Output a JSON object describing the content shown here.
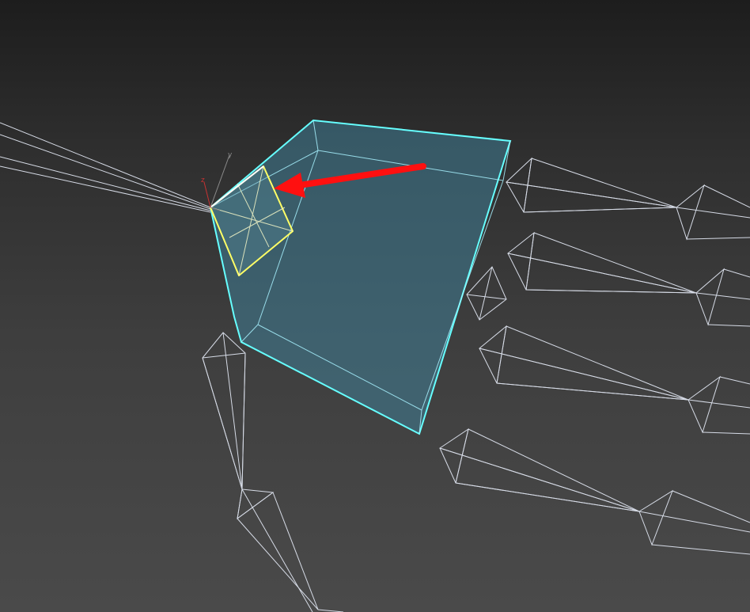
{
  "viewport": {
    "label": "",
    "background": "#3a3a3a"
  },
  "gizmo": {
    "x_label": "",
    "y_label": "y",
    "z_label": "z",
    "y_color": "#8a8a8a",
    "z_color": "#c83232"
  },
  "colors": {
    "bone_wire": "#d6dbe6",
    "selection_wire": "#66ffff",
    "selection_fill": "#3f7d95",
    "highlight": "#ffff66",
    "arrow": "#ff1010"
  },
  "icons": {
    "arrow": "annotation-arrow-icon",
    "gizmo": "transform-gizmo-icon"
  }
}
